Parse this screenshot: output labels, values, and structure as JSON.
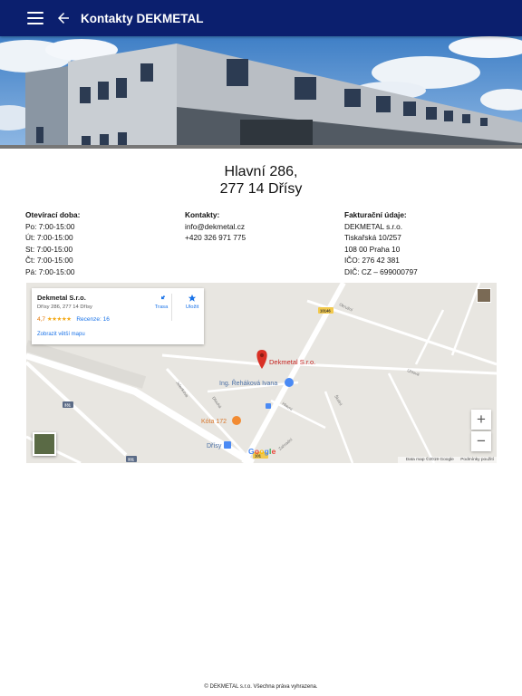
{
  "appbar": {
    "title": "Kontakty DEKMETAL",
    "menu_icon": "hamburger-menu-icon",
    "back_icon": "arrow-back-icon",
    "color": "#0b1f6e"
  },
  "address": {
    "line1": "Hlavní 286,",
    "line2": "277 14 Dřísy"
  },
  "hours": {
    "heading": "Otevírací doba:",
    "rows": [
      "Po: 7:00-15:00",
      "Út: 7:00-15:00",
      "St: 7:00-15:00",
      "Čt: 7:00-15:00",
      "Pá: 7:00-15:00"
    ]
  },
  "contacts": {
    "heading": "Kontakty:",
    "email": "info@dekmetal.cz",
    "phone": "+420 326 971 775"
  },
  "billing": {
    "heading": "Fakturační údaje:",
    "rows": [
      "DEKMETAL s.r.o.",
      "Tiskařská 10/257",
      "108 00 Praha 10",
      "IČO: 276 42 381",
      "DIČ: CZ – 699000797"
    ]
  },
  "map": {
    "card": {
      "name": "Dekmetal S.r.o.",
      "address": "Dřísy 286, 277 14 Dřísy",
      "rating": "4,7",
      "stars": "★★★★★",
      "reviews": "Recenze: 16",
      "bigger_map": "Zobrazit větší mapu",
      "route_label": "Trasa",
      "save_label": "Uložit"
    },
    "marker_label": "Dekmetal S.r.o.",
    "places": [
      "Ing. Řeháková Ivana",
      "Kóta 172",
      "Dřísy"
    ],
    "roads": [
      "Jelenkova",
      "Okružní",
      "Dlouhá",
      "Hlavní",
      "Zahradní",
      "Školní",
      "Dubová",
      "Úhlová"
    ],
    "road_numbers": [
      "10146",
      "331",
      "101"
    ],
    "zoom_in": "+",
    "zoom_out": "−",
    "google": "Google",
    "footer_data": "Data map ©2019 Google",
    "footer_terms": "Podmínky použití",
    "marker_color": "#d93025"
  },
  "footer": {
    "text": "© DEKMETAL s.r.o. Všechna práva vyhrazena."
  }
}
